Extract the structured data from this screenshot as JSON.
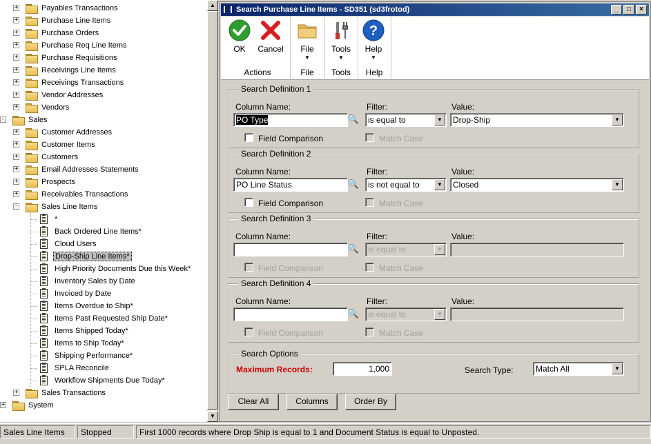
{
  "tree": {
    "rows": [
      {
        "label": "Payables Transactions",
        "level": 1,
        "kind": "folder",
        "expander": "+"
      },
      {
        "label": "Purchase Line Items",
        "level": 1,
        "kind": "folder",
        "expander": "+"
      },
      {
        "label": "Purchase Orders",
        "level": 1,
        "kind": "folder",
        "expander": "+"
      },
      {
        "label": "Purchase Req Line Items",
        "level": 1,
        "kind": "folder",
        "expander": "+"
      },
      {
        "label": "Purchase Requisitions",
        "level": 1,
        "kind": "folder",
        "expander": "+"
      },
      {
        "label": "Receivings Line Items",
        "level": 1,
        "kind": "folder",
        "expander": "+"
      },
      {
        "label": "Receivings Transactions",
        "level": 1,
        "kind": "folder",
        "expander": "+"
      },
      {
        "label": "Vendor Addresses",
        "level": 1,
        "kind": "folder",
        "expander": "+"
      },
      {
        "label": "Vendors",
        "level": 1,
        "kind": "folder",
        "expander": "+"
      },
      {
        "label": "Sales",
        "level": 0,
        "kind": "folder",
        "expander": "-"
      },
      {
        "label": "Customer Addresses",
        "level": 1,
        "kind": "folder",
        "expander": "+"
      },
      {
        "label": "Customer Items",
        "level": 1,
        "kind": "folder",
        "expander": "+"
      },
      {
        "label": "Customers",
        "level": 1,
        "kind": "folder",
        "expander": "+"
      },
      {
        "label": "Email Addresses Statements",
        "level": 1,
        "kind": "folder",
        "expander": "+"
      },
      {
        "label": "Prospects",
        "level": 1,
        "kind": "folder",
        "expander": "+"
      },
      {
        "label": "Receivables Transactions",
        "level": 1,
        "kind": "folder",
        "expander": "+"
      },
      {
        "label": "Sales Line Items",
        "level": 1,
        "kind": "folder",
        "expander": "-"
      },
      {
        "label": "*",
        "level": 2,
        "kind": "doc"
      },
      {
        "label": "Back Ordered Line Items*",
        "level": 2,
        "kind": "doc"
      },
      {
        "label": "Cloud Users",
        "level": 2,
        "kind": "doc"
      },
      {
        "label": "Drop-Ship Line Items*",
        "level": 2,
        "kind": "doc",
        "selected": true
      },
      {
        "label": "High Priority Documents Due this Week*",
        "level": 2,
        "kind": "doc"
      },
      {
        "label": "Inventory Sales by Date",
        "level": 2,
        "kind": "doc"
      },
      {
        "label": "Invoiced by Date",
        "level": 2,
        "kind": "doc"
      },
      {
        "label": "Items Overdue to Ship*",
        "level": 2,
        "kind": "doc"
      },
      {
        "label": "Items Past Requested Ship Date*",
        "level": 2,
        "kind": "doc"
      },
      {
        "label": "Items Shipped Today*",
        "level": 2,
        "kind": "doc"
      },
      {
        "label": "Items to Ship Today*",
        "level": 2,
        "kind": "doc"
      },
      {
        "label": "Shipping Performance*",
        "level": 2,
        "kind": "doc"
      },
      {
        "label": "SPLA Reconcile",
        "level": 2,
        "kind": "doc"
      },
      {
        "label": "Workflow Shipments Due Today*",
        "level": 2,
        "kind": "doc"
      },
      {
        "label": "Sales Transactions",
        "level": 1,
        "kind": "folder",
        "expander": "+"
      },
      {
        "label": "System",
        "level": 0,
        "kind": "folder",
        "expander": "+"
      }
    ]
  },
  "window": {
    "title": "Search Purchase Line Items  -  SD351 (sd3frotod)",
    "title_buttons": [
      "_",
      "□",
      "×"
    ]
  },
  "ribbon": {
    "ok_label": "OK",
    "cancel_label": "Cancel",
    "file_label": "File",
    "tools_label": "Tools",
    "help_label": "Help",
    "group_actions": "Actions",
    "group_file": "File",
    "group_tools": "Tools",
    "group_help": "Help",
    "arrow": "▼"
  },
  "labels": {
    "column_name": "Column Name:",
    "filter": "Filter:",
    "value": "Value:",
    "field_comparison": "Field Comparison",
    "match_case": "Match Case"
  },
  "search_definitions": [
    {
      "title": "Search Definition 1",
      "column": "PO Type",
      "filter": "is equal to",
      "value": "Drop-Ship"
    },
    {
      "title": "Search Definition 2",
      "column": "PO Line Status",
      "filter": "is not equal to",
      "value": "Closed"
    },
    {
      "title": "Search Definition 3",
      "column": "",
      "filter": "is equal to",
      "value": ""
    },
    {
      "title": "Search Definition 4",
      "column": "",
      "filter": "is equal to",
      "value": ""
    }
  ],
  "search_options": {
    "title": "Search Options",
    "max_records_label": "Maximum Records:",
    "max_records_value": "1,000",
    "search_type_label": "Search Type:",
    "search_type_value": "Match All"
  },
  "buttons": {
    "clear_all": "Clear All",
    "columns": "Columns",
    "order_by": "Order By"
  },
  "statusbar": {
    "section": "Sales Line Items",
    "state": "Stopped",
    "message": "First 1000 records where Drop Ship is equal to 1 and Document Status is equal to Unposted."
  },
  "colors": {
    "title_bar": "#0a246a",
    "max_records_label": "#cc0000",
    "ok_green": "#2e9e2e",
    "cancel_red": "#d81e1e",
    "help_blue": "#1f5fc0"
  }
}
